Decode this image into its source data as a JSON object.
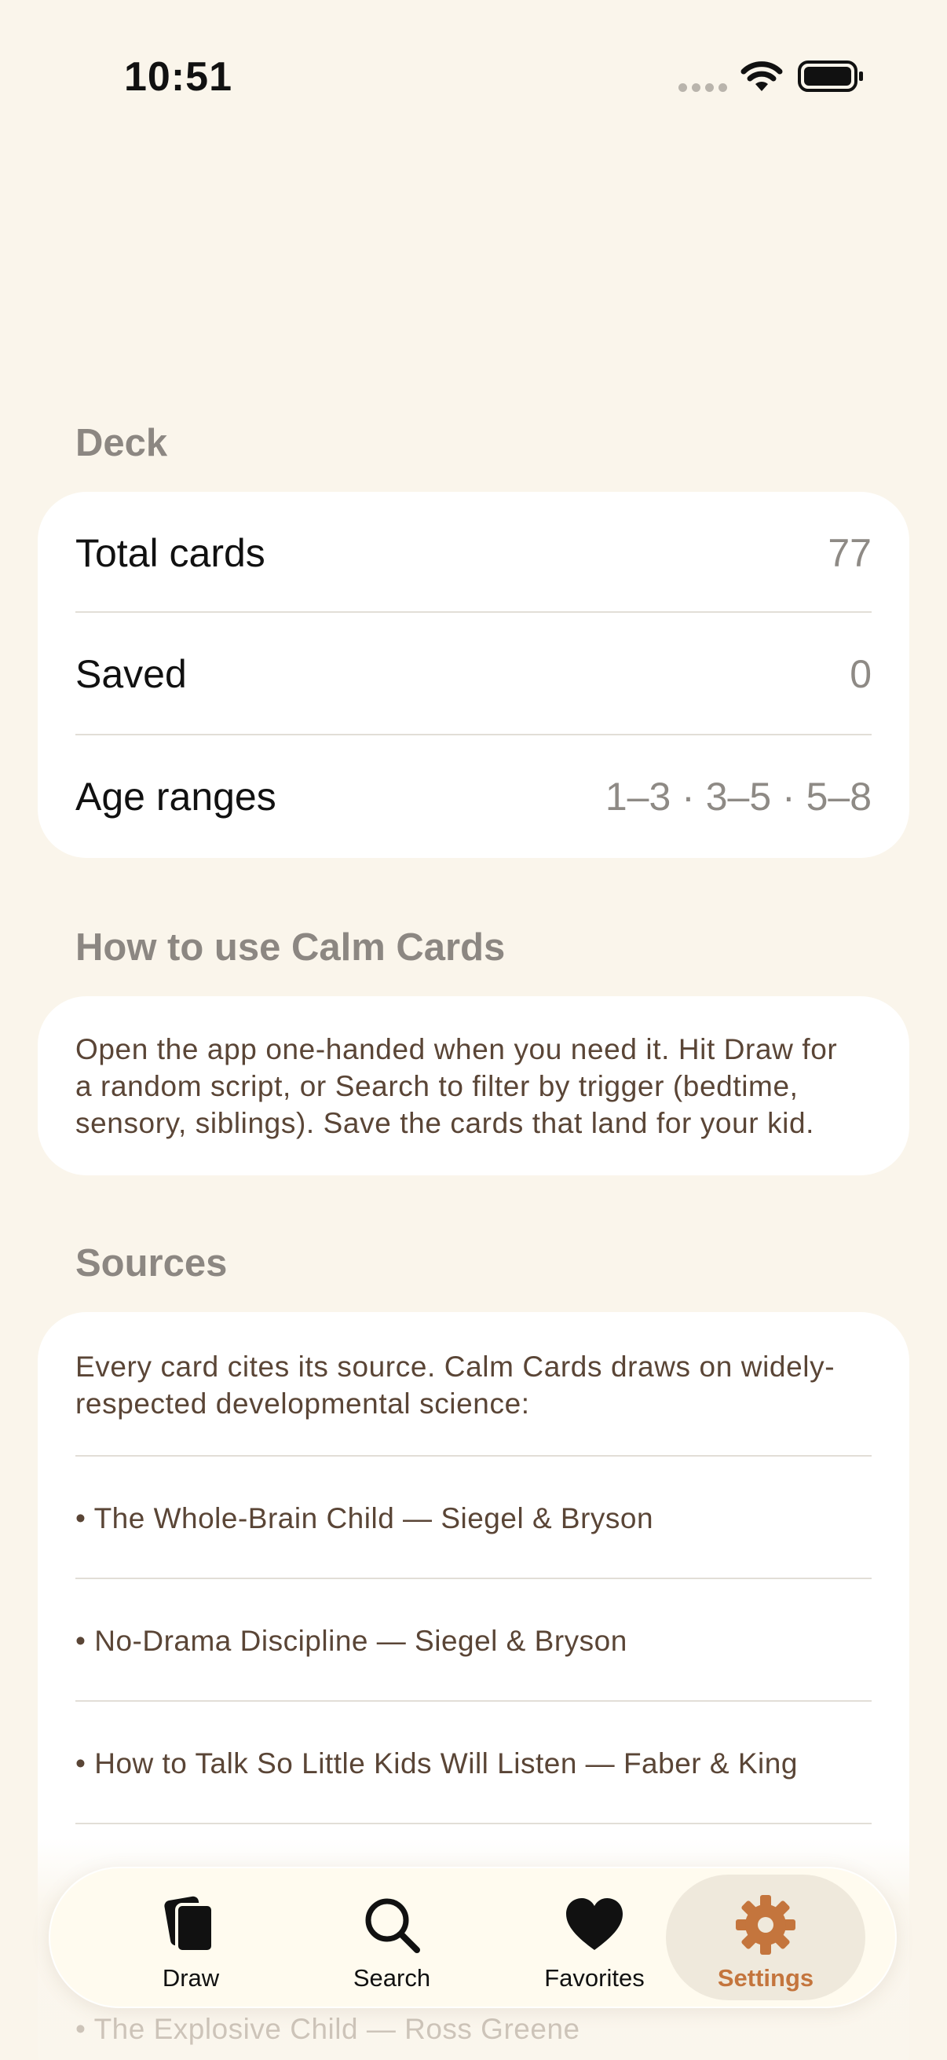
{
  "status_bar": {
    "time": "10:51"
  },
  "deck": {
    "header": "Deck",
    "rows": [
      {
        "label": "Total cards",
        "value": "77"
      },
      {
        "label": "Saved",
        "value": "0"
      },
      {
        "label": "Age ranges",
        "value": "1–3 · 3–5 · 5–8"
      }
    ]
  },
  "how_to": {
    "header": "How to use Calm Cards",
    "text_lines": [
      "Open the app one-handed when you need it. Hit Draw for",
      "a random script, or Search to filter by trigger (bedtime,",
      "sensory, siblings). Save the cards that land for your kid."
    ]
  },
  "sources": {
    "header": "Sources",
    "intro_lines": [
      "Every card cites its source. Calm Cards draws on widely-",
      "respected developmental science:"
    ],
    "items": [
      "• The Whole-Brain Child — Siegel & Bryson",
      "• No-Drama Discipline — Siegel & Bryson",
      "• How to Talk So Little Kids Will Listen — Faber & King",
      "• The Explosive Child — Ross Greene"
    ]
  },
  "tab_bar": {
    "tabs": [
      {
        "label": "Draw",
        "icon": "cards-icon"
      },
      {
        "label": "Search",
        "icon": "search-icon"
      },
      {
        "label": "Favorites",
        "icon": "heart-icon"
      },
      {
        "label": "Settings",
        "icon": "gear-icon"
      }
    ],
    "active_color": "#C4753D"
  }
}
